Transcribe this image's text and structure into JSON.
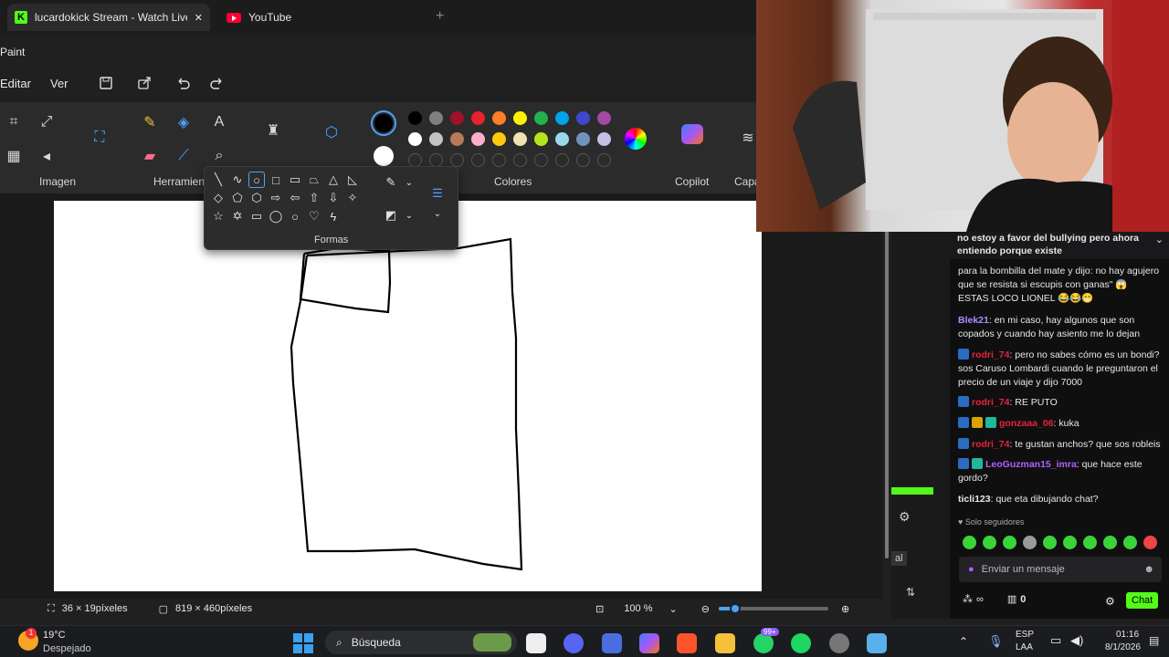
{
  "browser": {
    "tabs": [
      {
        "title": "lucardokick Stream - Watch Live"
      },
      {
        "title": "YouTube"
      }
    ],
    "close_glyph": "✕",
    "new_tab_glyph": "+"
  },
  "paint": {
    "app_title": "Paint",
    "menu": [
      "Editar",
      "Ver"
    ],
    "groups": {
      "image": "Imagen",
      "tools": "Herramien",
      "colors": "Colores",
      "copilot": "Copilot",
      "layers": "Capa"
    },
    "palette_row1": [
      "#000000",
      "#7f7f7f",
      "#a0102a",
      "#e8222c",
      "#ff7f27",
      "#fff200",
      "#22b14c",
      "#00a2e8",
      "#3f48cc",
      "#a349a4"
    ],
    "palette_row2": [
      "#ffffff",
      "#c3c3c3",
      "#b97a57",
      "#ffaec9",
      "#ffc90e",
      "#efe4b0",
      "#b5e61d",
      "#99d9ea",
      "#7092be",
      "#c8bfe7"
    ],
    "primary_color": "#000000",
    "secondary_color": "#ffffff",
    "shapes_popup_label": "Formas",
    "status": {
      "selection_size": "36 × 19píxeles",
      "canvas_size": "819 × 460píxeles",
      "zoom": "100 %"
    }
  },
  "chat": {
    "pinned": "no estoy a favor del bullying pero ahora entiendo porque existe",
    "messages": [
      {
        "user": "",
        "user_color": "#e8e8e8",
        "text": "para la bombilla del mate y dijo: no hay agujero que se resista si escupis con ganas\" 😱 ESTAS LOCO LIONEL 😂😂😁"
      },
      {
        "user": "Blek21",
        "user_color": "#b08cff",
        "text": "en mi caso, hay algunos que son copados y cuando hay asiento me lo dejan"
      },
      {
        "user": "rodri_74",
        "user_color": "#e8223c",
        "text": "pero no sabes cómo es un bondi? sos Caruso Lombardi cuando le preguntaron el precio de un viaje y dijo 7000"
      },
      {
        "user": "rodri_74",
        "user_color": "#e8223c",
        "text": "RE PUTO"
      },
      {
        "user": "gonzaaa_06",
        "user_color": "#e8223c",
        "text": "kuka"
      },
      {
        "user": "rodri_74",
        "user_color": "#e8223c",
        "text": "te gustan anchos? que sos robleis"
      },
      {
        "user": "LeoGuzman15_imra",
        "user_color": "#b060ff",
        "text": "que hace este gordo?"
      },
      {
        "user": "ticli123",
        "user_color": "#e8e8e8",
        "text": "que eta dibujando chat?"
      }
    ],
    "followers_only": "Solo seguidores",
    "input_placeholder": "Enviar un mensaje",
    "viewer_count": "∞",
    "points": "0",
    "chat_button": "Chat",
    "side_label": "al"
  },
  "taskbar": {
    "weather_temp": "19°C",
    "weather_desc": "Despejado",
    "search_label": "Búsqueda",
    "lang_top": "ESP",
    "lang_bottom": "LAA",
    "time": "01:16",
    "date": "8/1/2026",
    "badge_count": "99+"
  }
}
